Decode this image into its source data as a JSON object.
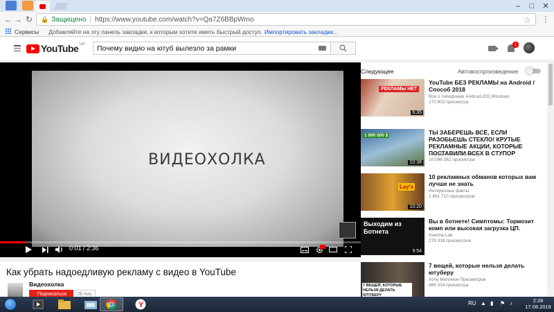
{
  "browser": {
    "omnibox": {
      "secure_label": "Защищено",
      "url": "https://www.youtube.com/watch?v=Qa7Z6BBpWmo"
    },
    "bookmarks": {
      "apps_label": "Сервисы",
      "hint": "Добавляйте на эту панель закладки, к которым хотите иметь быстрый доступ.",
      "import_link": "Импортировать закладки..."
    }
  },
  "masthead": {
    "logo": "YouTube",
    "region": "UA",
    "search_query": "Почему видио на ютуб вылезло за рамки",
    "notification_count": "1"
  },
  "player": {
    "overlay_title": "ВИДЕОХОЛКА",
    "time": "0:01 / 2:36",
    "progress_fraction": 0.07
  },
  "video": {
    "title": "Как убрать надоедливую рекламу с видео в YouTube",
    "channel": "Видеохолка",
    "subscribe_label": "Подписаться",
    "subscriber_count": "28 тыс."
  },
  "sidebar": {
    "up_next_label": "Следующее",
    "autoplay_label": "Автовоспроизведение",
    "items": [
      {
        "title": "YouTube БЕЗ РЕКЛАМЫ на Android / Способ 2018",
        "channel": "Все о телефонах Android,iOS,Windows",
        "views": "173 602 просмотра",
        "duration": "6:35",
        "thumb_text": "РЕКЛАМЫ НЕТ"
      },
      {
        "title": "ТЫ ЗАБЕРЕШЬ ВСЁ, ЕСЛИ РАЗОБЬЕШЬ СТЕКЛО! КРУТЫЕ РЕКЛАМНЫЕ АКЦИИ, КОТОРЫЕ ПОСТАВИЛИ ВСЕХ В СТУПОР",
        "channel": "Мастерская Настроения",
        "views": "10 096 382 просмотра",
        "duration": "10:38",
        "thumb_text": "1 000 000 $"
      },
      {
        "title": "10 рекламных обманов которых вам лучше не знать",
        "channel": "Интересные факты",
        "views": "1 891 710 просмотров",
        "duration": "10:20",
        "thumb_text": "Lay's"
      },
      {
        "title": "Вы в ботнете! Симптомы: Тормозит комп или высокая загрузка ЦП.",
        "channel": "Averina Lab",
        "views": "279 318 просмотров",
        "duration": "9:54",
        "thumb_text": "Выходим из Ботнета"
      },
      {
        "title": "7 вещей, которые нельзя делать ютуберу",
        "channel": "Хочу Миллион Просмотров",
        "views": "465 024 просмотра",
        "duration": "",
        "thumb_text": "7 ВЕЩЕЙ, КОТОРЫЕ НЕЛЬЗЯ ДЕЛАТЬ ЮТУБЕРУ"
      }
    ]
  },
  "taskbar": {
    "language": "RU",
    "time": "2:28",
    "date": "17.08.2018"
  },
  "colors": {
    "youtube_red": "#ff0000",
    "secure_green": "#0b8043",
    "taskbar": "#1c2636"
  }
}
